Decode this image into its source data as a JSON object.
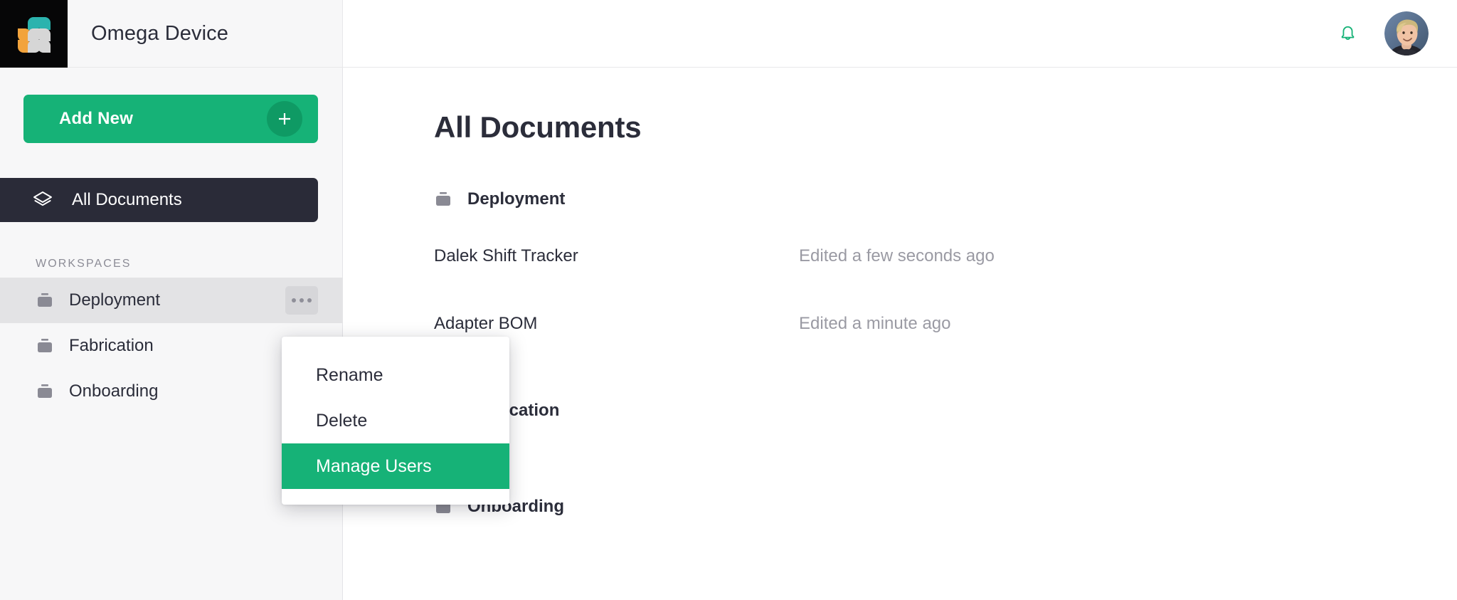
{
  "brand": {
    "title": "Omega Device",
    "logo_icon": "petal-grid-logo",
    "logo_colors": {
      "teal": "#2bb3ae",
      "orange": "#f2a33c",
      "gray": "#d6d6d6",
      "background": "#060607"
    }
  },
  "topbar": {
    "notifications_icon": "bell-icon",
    "notifications_color": "#16b277",
    "avatar_icon": "user-avatar"
  },
  "sidebar": {
    "add_new": {
      "label": "Add New",
      "icon": "plus-icon"
    },
    "primary_nav": {
      "label": "All Documents",
      "icon": "layers-icon",
      "active": true
    },
    "section_label": "WORKSPACES",
    "workspaces": [
      {
        "label": "Deployment",
        "icon": "briefcase-icon",
        "active": true,
        "menu_icon": "ellipsis-icon"
      },
      {
        "label": "Fabrication",
        "icon": "briefcase-icon",
        "active": false,
        "menu_icon": "ellipsis-icon"
      },
      {
        "label": "Onboarding",
        "icon": "briefcase-icon",
        "active": false,
        "menu_icon": "ellipsis-icon"
      }
    ]
  },
  "main": {
    "page_title": "All Documents",
    "groups": [
      {
        "title": "Deployment",
        "icon": "briefcase-icon",
        "documents": [
          {
            "name": "Dalek Shift Tracker",
            "edited": "Edited a few seconds ago"
          },
          {
            "name": "Adapter BOM",
            "edited": "Edited a minute ago"
          }
        ]
      },
      {
        "title": "Fabrication",
        "icon": "briefcase-icon",
        "documents": []
      },
      {
        "title": "Onboarding",
        "icon": "briefcase-icon",
        "documents": []
      }
    ]
  },
  "context_menu": {
    "visible": true,
    "items": [
      {
        "label": "Rename",
        "highlighted": false
      },
      {
        "label": "Delete",
        "highlighted": false
      },
      {
        "label": "Manage Users",
        "highlighted": true
      }
    ],
    "highlight_color": "#16b277"
  },
  "colors": {
    "accent_green": "#16b277",
    "accent_green_dark": "#0f9a64",
    "dark_nav": "#2a2b38",
    "sidebar_bg": "#f7f7f8",
    "text_primary": "#2b2d3a",
    "text_muted": "#9a9aa3"
  }
}
